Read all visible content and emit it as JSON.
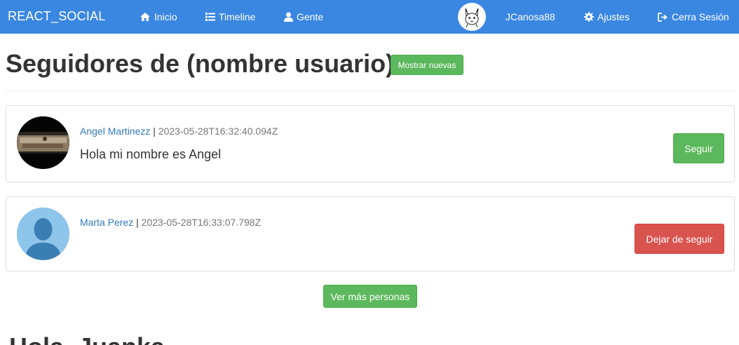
{
  "navbar": {
    "brand": "REACT_SOCIAL",
    "items": [
      {
        "label": "Inicio",
        "icon": "home-icon"
      },
      {
        "label": "Timeline",
        "icon": "list-icon"
      },
      {
        "label": "Gente",
        "icon": "user-icon"
      }
    ],
    "avatar_icon": "pikachu-avatar",
    "username": "JCanosa88",
    "settings_label": "Ajustes",
    "settings_icon": "gear-icon",
    "logout_label": "Cerra Sesión",
    "logout_icon": "logout-icon"
  },
  "page": {
    "title": "Seguidores de (nombre usuario)",
    "show_new_label": "Mostrar nuevas"
  },
  "followers": [
    {
      "name": "Angel Martinezz",
      "separator": "|",
      "timestamp": "2023-05-28T16:32:40.094Z",
      "bio": "Hola mi nombre es Angel",
      "action_label": "Seguir",
      "action_type": "follow"
    },
    {
      "name": "Marta Perez",
      "separator": "|",
      "timestamp": "2023-05-28T16:33:07.798Z",
      "bio": "",
      "action_label": "Dejar de seguir",
      "action_type": "unfollow"
    }
  ],
  "more_label": "Ver más personas",
  "footer_heading": "Hola, Juanka",
  "colors": {
    "navbar": "#3a87e1",
    "success": "#5cb85c",
    "danger": "#d9534f",
    "link": "#337ab7"
  }
}
